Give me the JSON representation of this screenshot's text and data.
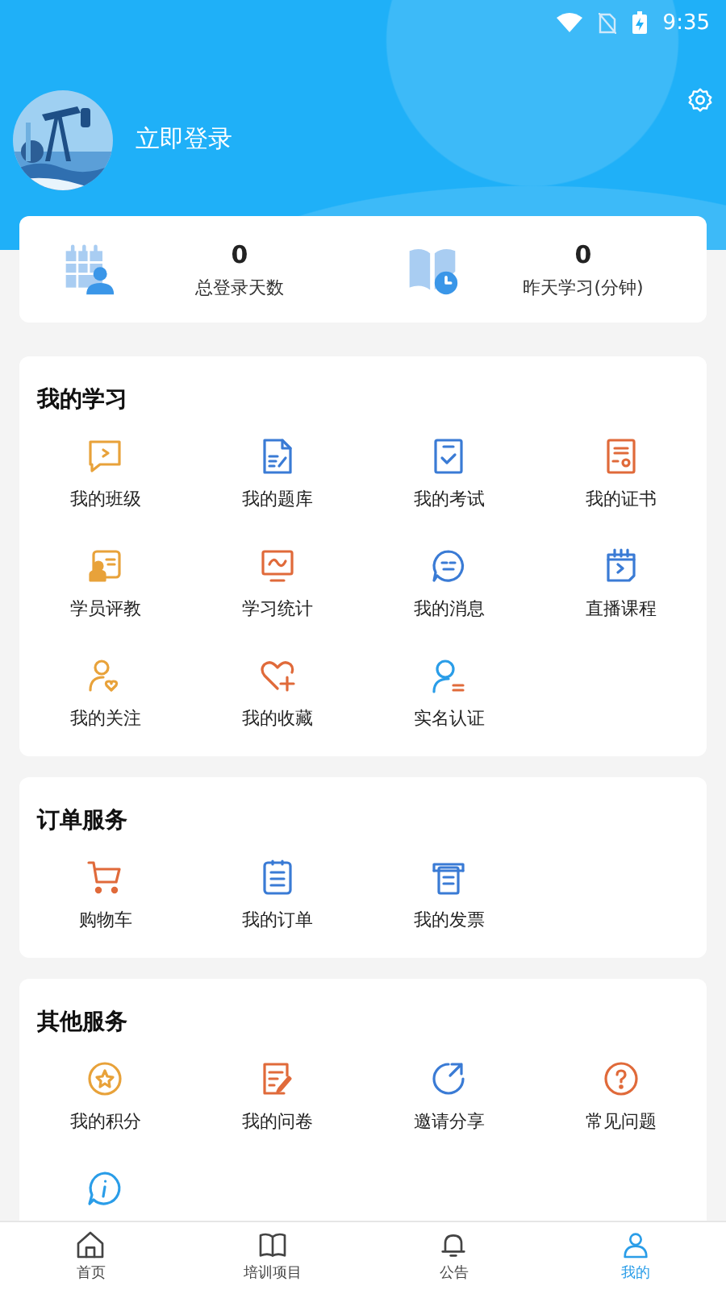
{
  "status_bar": {
    "time": "9:35"
  },
  "profile": {
    "login_label": "立即登录"
  },
  "stats": [
    {
      "value": "0",
      "label": "总登录天数",
      "kind": "calendar-user"
    },
    {
      "value": "0",
      "label": "昨天学习(分钟)",
      "kind": "book-clock"
    }
  ],
  "sections": [
    {
      "title": "我的学习",
      "items": [
        {
          "label": "我的班级",
          "kind": "chat-play",
          "color": "#e8a23a"
        },
        {
          "label": "我的题库",
          "kind": "doc-edit",
          "color": "#3a7bd5"
        },
        {
          "label": "我的考试",
          "kind": "checklist",
          "color": "#3a7bd5"
        },
        {
          "label": "我的证书",
          "kind": "certificate",
          "color": "#e06a3a"
        },
        {
          "label": "学员评教",
          "kind": "teacher",
          "color": "#e8a23a"
        },
        {
          "label": "学习统计",
          "kind": "monitor",
          "color": "#e06a3a"
        },
        {
          "label": "我的消息",
          "kind": "message",
          "color": "#3a7bd5"
        },
        {
          "label": "直播课程",
          "kind": "calendar-play",
          "color": "#3a7bd5"
        },
        {
          "label": "我的关注",
          "kind": "user-heart",
          "color": "#e8a23a"
        },
        {
          "label": "我的收藏",
          "kind": "heart-plus",
          "color": "#e06a3a"
        },
        {
          "label": "实名认证",
          "kind": "user-id",
          "color": "#2a9de8"
        }
      ]
    },
    {
      "title": "订单服务",
      "items": [
        {
          "label": "购物车",
          "kind": "cart",
          "color": "#e06a3a"
        },
        {
          "label": "我的订单",
          "kind": "clipboard",
          "color": "#3a7bd5"
        },
        {
          "label": "我的发票",
          "kind": "printer",
          "color": "#3a7bd5"
        }
      ]
    },
    {
      "title": "其他服务",
      "items": [
        {
          "label": "我的积分",
          "kind": "star-circle",
          "color": "#e8a23a"
        },
        {
          "label": "我的问卷",
          "kind": "doc-pen",
          "color": "#e06a3a"
        },
        {
          "label": "邀请分享",
          "kind": "refresh",
          "color": "#3a7bd5"
        },
        {
          "label": "常见问题",
          "kind": "question",
          "color": "#e06a3a"
        },
        {
          "kind": "info",
          "color": "#2a9de8"
        }
      ]
    }
  ],
  "tabs": [
    {
      "label": "首页",
      "kind": "home",
      "selected": false
    },
    {
      "label": "培训项目",
      "kind": "book",
      "selected": false
    },
    {
      "label": "公告",
      "kind": "bell",
      "selected": false
    },
    {
      "label": "我的",
      "kind": "person",
      "selected": true
    }
  ]
}
